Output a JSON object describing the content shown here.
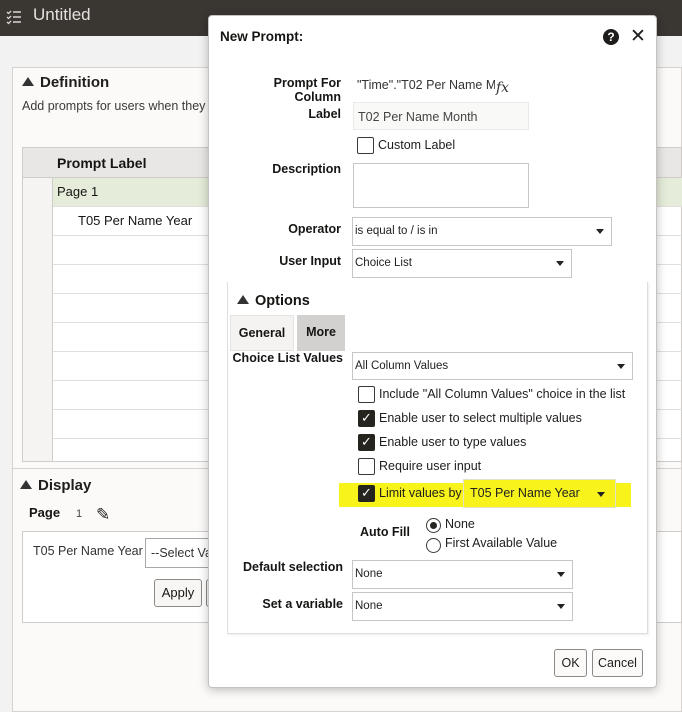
{
  "app": {
    "title": "Untitled",
    "definition": {
      "heading": "Definition",
      "hint": "Add prompts for users when they",
      "column_header": "Prompt Label",
      "rows": [
        "Page 1",
        "T05 Per Name Year"
      ]
    },
    "display": {
      "heading": "Display",
      "page_label": "Page",
      "page_value": "1",
      "prompt_label": "T05 Per Name Year",
      "select_placeholder": "--Select Va",
      "apply_label": "Apply"
    }
  },
  "dialog": {
    "title": "New Prompt:",
    "help_glyph": "?",
    "close_glyph": "✕",
    "fields": {
      "prompt_for_column_label": "Prompt For Column",
      "prompt_for_column_value": "\"Time\".\"T02 Per Name M",
      "fx_glyph": "fx",
      "label_label": "Label",
      "label_value": "T02 Per Name Month",
      "custom_label": "Custom Label",
      "description_label": "Description",
      "operator_label": "Operator",
      "operator_value": "is equal to / is in",
      "user_input_label": "User Input",
      "user_input_value": "Choice List"
    },
    "options": {
      "heading": "Options",
      "tabs": [
        "General",
        "More"
      ],
      "choice_list_values_label": "Choice List Values",
      "choice_list_values_value": "All Column Values",
      "checkboxes": [
        {
          "label": "Include \"All Column Values\" choice in the list",
          "checked": false
        },
        {
          "label": "Enable user to select multiple values",
          "checked": true
        },
        {
          "label": "Enable user to type values",
          "checked": true
        },
        {
          "label": "Require user input",
          "checked": false
        },
        {
          "label": "Limit values by",
          "checked": true
        }
      ],
      "limit_by_value": "T05 Per Name Year",
      "auto_fill_label": "Auto Fill",
      "auto_fill_options": [
        "None",
        "First Available Value"
      ],
      "auto_fill_selected": "None",
      "default_selection_label": "Default selection",
      "default_selection_value": "None",
      "set_variable_label": "Set a variable",
      "set_variable_value": "None"
    },
    "buttons": {
      "ok": "OK",
      "cancel": "Cancel"
    },
    "highlight_color": "#f7f31b"
  }
}
